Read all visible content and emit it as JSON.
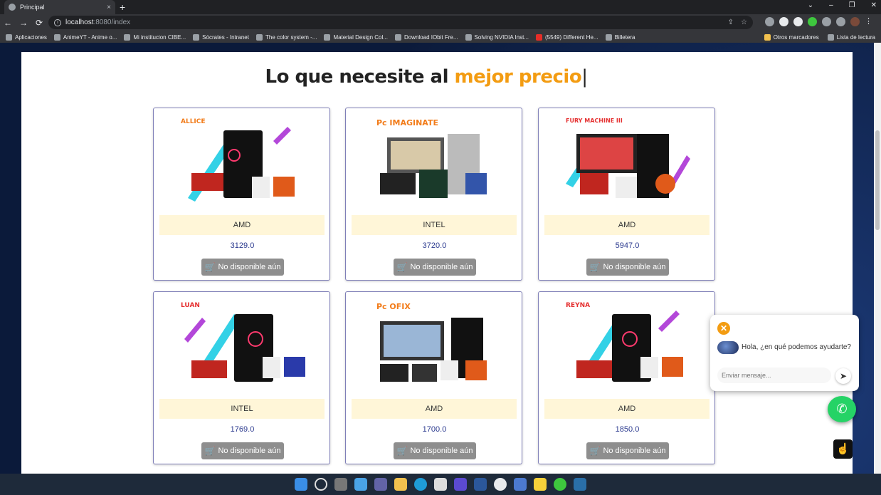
{
  "browser": {
    "tab_title": "Principal",
    "tab_close": "×",
    "new_tab": "+",
    "window_controls": [
      "⌄",
      "–",
      "❐",
      "✕"
    ],
    "nav": {
      "back": "←",
      "forward": "→",
      "reload": "⟳"
    },
    "url_host": "localhost",
    "url_path": ":8080/index",
    "bookmarks": [
      "Aplicaciones",
      "AnimeYT - Anime o...",
      "Mi institucion CIBE...",
      "Sócrates - Intranet",
      "The color system -...",
      "Material Design Col...",
      "Download IObit Fre...",
      "Solving NVIDIA Inst...",
      "(5549) Different He...",
      "Billetera"
    ],
    "bookmarks_right": [
      "Otros marcadores",
      "Lista de lectura"
    ]
  },
  "page": {
    "heading_main": "Lo que necesite al ",
    "heading_accent": "mejor precio",
    "heading_caret": "|"
  },
  "products": [
    {
      "brand": "AMD",
      "price": "3129.0",
      "button": "No disponible aún",
      "image_label": "ALLICE"
    },
    {
      "brand": "INTEL",
      "price": "3720.0",
      "button": "No disponible aún",
      "image_label": "Pc IMAGINATE"
    },
    {
      "brand": "AMD",
      "price": "5947.0",
      "button": "No disponible aún",
      "image_label": "FURY MACHINE III"
    },
    {
      "brand": "INTEL",
      "price": "1769.0",
      "button": "No disponible aún",
      "image_label": "LUAN"
    },
    {
      "brand": "AMD",
      "price": "1700.0",
      "button": "No disponible aún",
      "image_label": "Pc OFIX"
    },
    {
      "brand": "AMD",
      "price": "1850.0",
      "button": "No disponible aún",
      "image_label": "REYNA"
    }
  ],
  "chat": {
    "close": "✕",
    "message": "Hola, ¿en qué podemos ayudarte?",
    "placeholder": "Enviar mensaje...",
    "send": "➤"
  },
  "colors": {
    "accent": "#f39c12",
    "card_border": "#7f7fb8",
    "brand_band": "#fff6d8",
    "button": "#8e8e8e",
    "whatsapp": "#25d366"
  }
}
